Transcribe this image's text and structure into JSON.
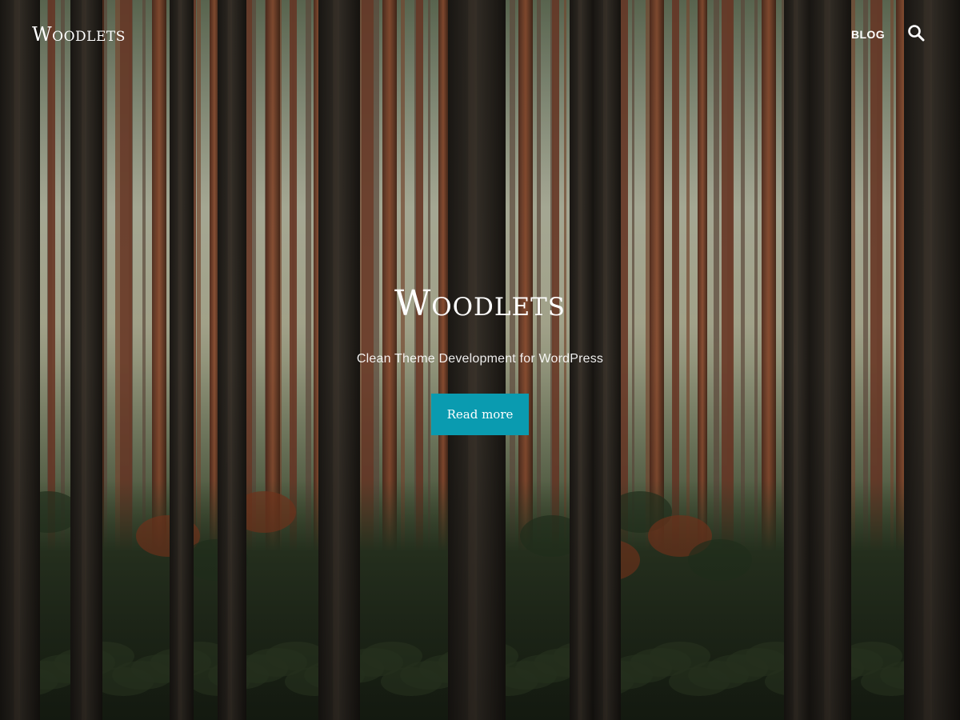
{
  "header": {
    "site_title": "Woodlets",
    "nav": [
      {
        "label": "BLOG"
      }
    ],
    "search_icon": "search-icon"
  },
  "hero": {
    "title": "Woodlets",
    "tagline": "Clean Theme Development for WordPress",
    "button_label": "Read more",
    "background": "forest-photo"
  },
  "colors": {
    "accent": "#0a9bb0",
    "text": "#ffffff"
  }
}
